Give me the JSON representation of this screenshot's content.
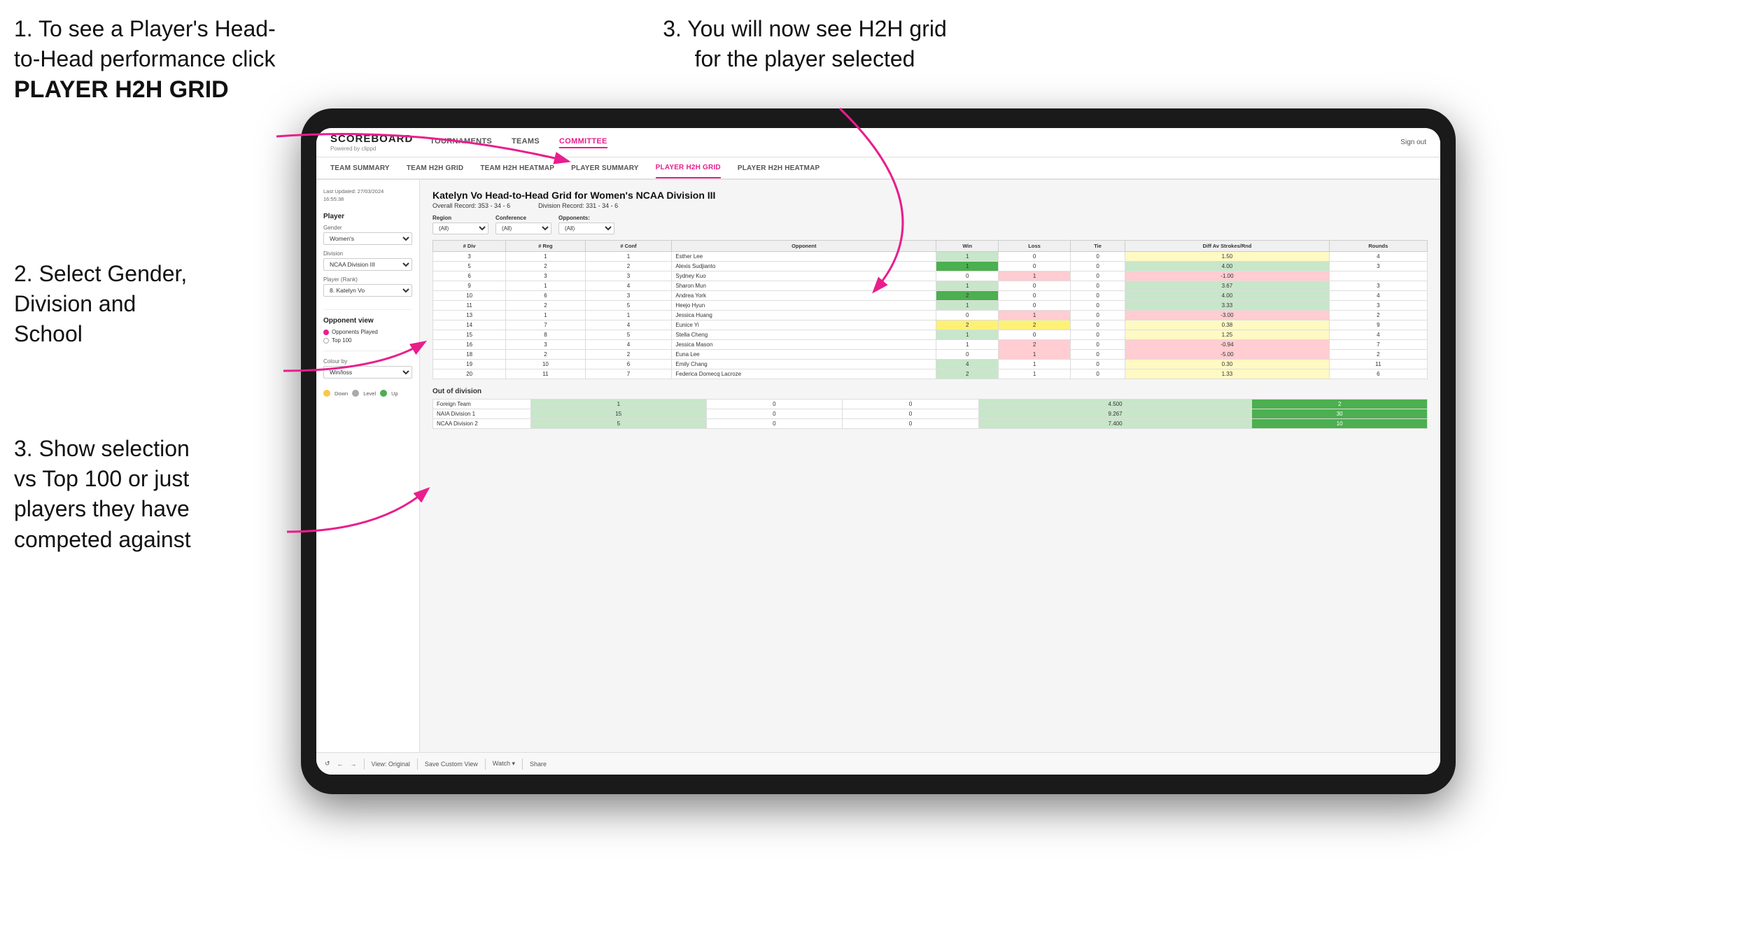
{
  "instructions": {
    "top_left": {
      "line1": "1. To see a Player's Head-",
      "line2": "to-Head performance click",
      "bold": "PLAYER H2H GRID"
    },
    "top_right": {
      "line1": "3. You will now see H2H grid",
      "line2": "for the player selected"
    },
    "mid_left": {
      "line1": "2. Select Gender,",
      "line2": "Division and",
      "line3": "School"
    },
    "bot_left": {
      "line1": "3. Show selection",
      "line2": "vs Top 100 or just",
      "line3": "players they have",
      "line4": "competed against"
    }
  },
  "header": {
    "logo": "SCOREBOARD",
    "logo_sub": "Powered by clippd",
    "nav": [
      "TOURNAMENTS",
      "TEAMS",
      "COMMITTEE"
    ],
    "active_nav": "COMMITTEE",
    "sign_out": "Sign out"
  },
  "sub_nav": {
    "items": [
      "TEAM SUMMARY",
      "TEAM H2H GRID",
      "TEAM H2H HEATMAP",
      "PLAYER SUMMARY",
      "PLAYER H2H GRID",
      "PLAYER H2H HEATMAP"
    ],
    "active": "PLAYER H2H GRID"
  },
  "left_panel": {
    "last_updated_label": "Last Updated: 27/03/2024",
    "last_updated_time": "16:55:38",
    "player_section": "Player",
    "gender_label": "Gender",
    "gender_value": "Women's",
    "division_label": "Division",
    "division_value": "NCAA Division III",
    "player_rank_label": "Player (Rank)",
    "player_rank_value": "8. Katelyn Vo",
    "opponent_view_label": "Opponent view",
    "opponent_options": [
      {
        "label": "Opponents Played",
        "selected": true
      },
      {
        "label": "Top 100",
        "selected": false
      }
    ],
    "colour_by_label": "Colour by",
    "colour_value": "Win/loss",
    "colour_legend": [
      {
        "color": "#f9c74f",
        "label": "Down"
      },
      {
        "color": "#aaaaaa",
        "label": "Level"
      },
      {
        "color": "#4caf50",
        "label": "Up"
      }
    ]
  },
  "grid": {
    "title": "Katelyn Vo Head-to-Head Grid for Women's NCAA Division III",
    "overall_record_label": "Overall Record:",
    "overall_record": "353 - 34 - 6",
    "division_record_label": "Division Record:",
    "division_record": "331 - 34 - 6",
    "filters": {
      "region_label": "Region",
      "region_value": "(All)",
      "conference_label": "Conference",
      "conference_value": "(All)",
      "opponent_label": "Opponent",
      "opponent_value": "(All)",
      "opponents_label": "Opponents:"
    },
    "columns": [
      "# Div",
      "# Reg",
      "# Conf",
      "Opponent",
      "Win",
      "Loss",
      "Tie",
      "Diff Av Strokes/Rnd",
      "Rounds"
    ],
    "rows": [
      {
        "div": "3",
        "reg": "1",
        "conf": "1",
        "opponent": "Esther Lee",
        "win": 1,
        "loss": 0,
        "tie": 0,
        "diff": "1.50",
        "rounds": "4",
        "win_color": "green-light",
        "loss_color": "",
        "tie_color": ""
      },
      {
        "div": "5",
        "reg": "2",
        "conf": "2",
        "opponent": "Alexis Sudjianto",
        "win": 1,
        "loss": 0,
        "tie": 0,
        "diff": "4.00",
        "rounds": "3",
        "win_color": "green-dark",
        "loss_color": "",
        "tie_color": ""
      },
      {
        "div": "6",
        "reg": "3",
        "conf": "3",
        "opponent": "Sydney Kuo",
        "win": 0,
        "loss": 1,
        "tie": 0,
        "diff": "-1.00",
        "rounds": "",
        "win_color": "",
        "loss_color": "red-light",
        "tie_color": ""
      },
      {
        "div": "9",
        "reg": "1",
        "conf": "4",
        "opponent": "Sharon Mun",
        "win": 1,
        "loss": 0,
        "tie": 0,
        "diff": "3.67",
        "rounds": "3",
        "win_color": "green-light",
        "loss_color": "",
        "tie_color": ""
      },
      {
        "div": "10",
        "reg": "6",
        "conf": "3",
        "opponent": "Andrea York",
        "win": 2,
        "loss": 0,
        "tie": 0,
        "diff": "4.00",
        "rounds": "4",
        "win_color": "green-dark",
        "loss_color": "",
        "tie_color": ""
      },
      {
        "div": "11",
        "reg": "2",
        "conf": "5",
        "opponent": "Heejo Hyun",
        "win": 1,
        "loss": 0,
        "tie": 0,
        "diff": "3.33",
        "rounds": "3",
        "win_color": "green-light",
        "loss_color": "",
        "tie_color": ""
      },
      {
        "div": "13",
        "reg": "1",
        "conf": "1",
        "opponent": "Jessica Huang",
        "win": 0,
        "loss": 1,
        "tie": 0,
        "diff": "-3.00",
        "rounds": "2",
        "win_color": "",
        "loss_color": "red-light",
        "tie_color": ""
      },
      {
        "div": "14",
        "reg": "7",
        "conf": "4",
        "opponent": "Eunice Yi",
        "win": 2,
        "loss": 2,
        "tie": 0,
        "diff": "0.38",
        "rounds": "9",
        "win_color": "yellow",
        "loss_color": "yellow",
        "tie_color": ""
      },
      {
        "div": "15",
        "reg": "8",
        "conf": "5",
        "opponent": "Stella Cheng",
        "win": 1,
        "loss": 0,
        "tie": 0,
        "diff": "1.25",
        "rounds": "4",
        "win_color": "green-light",
        "loss_color": "",
        "tie_color": ""
      },
      {
        "div": "16",
        "reg": "3",
        "conf": "4",
        "opponent": "Jessica Mason",
        "win": 1,
        "loss": 2,
        "tie": 0,
        "diff": "-0.94",
        "rounds": "7",
        "win_color": "",
        "loss_color": "red-light",
        "tie_color": ""
      },
      {
        "div": "18",
        "reg": "2",
        "conf": "2",
        "opponent": "Euna Lee",
        "win": 0,
        "loss": 1,
        "tie": 0,
        "diff": "-5.00",
        "rounds": "2",
        "win_color": "",
        "loss_color": "red-light",
        "tie_color": ""
      },
      {
        "div": "19",
        "reg": "10",
        "conf": "6",
        "opponent": "Emily Chang",
        "win": 4,
        "loss": 1,
        "tie": 0,
        "diff": "0.30",
        "rounds": "11",
        "win_color": "green-light",
        "loss_color": "",
        "tie_color": ""
      },
      {
        "div": "20",
        "reg": "11",
        "conf": "7",
        "opponent": "Federica Domecq Lacroze",
        "win": 2,
        "loss": 1,
        "tie": 0,
        "diff": "1.33",
        "rounds": "6",
        "win_color": "green-light",
        "loss_color": "",
        "tie_color": ""
      }
    ],
    "out_of_division_label": "Out of division",
    "out_of_division_rows": [
      {
        "label": "Foreign Team",
        "win": 1,
        "loss": 0,
        "tie": 0,
        "diff": "4.500",
        "rounds": "2"
      },
      {
        "label": "NAIA Division 1",
        "win": 15,
        "loss": 0,
        "tie": 0,
        "diff": "9.267",
        "rounds": "30"
      },
      {
        "label": "NCAA Division 2",
        "win": 5,
        "loss": 0,
        "tie": 0,
        "diff": "7.400",
        "rounds": "10"
      }
    ]
  },
  "toolbar": {
    "items": [
      "↺",
      "←",
      "→",
      "⊞",
      "↗↙",
      "⟳",
      "View: Original",
      "Save Custom View",
      "Watch ▾",
      "↗",
      "⟷",
      "Share"
    ]
  }
}
